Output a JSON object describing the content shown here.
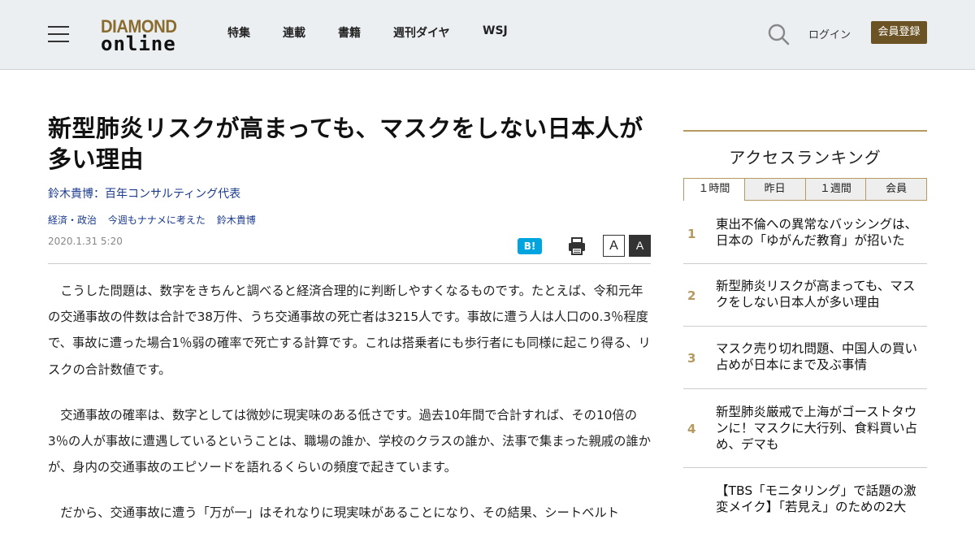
{
  "header": {
    "logo_top": "DIAMOND",
    "logo_bottom": "online",
    "nav": [
      "特集",
      "連載",
      "書籍",
      "週刊ダイヤ",
      "WSJ"
    ],
    "login": "ログイン",
    "register": "会員登録"
  },
  "article": {
    "title": "新型肺炎リスクが高まっても、マスクをしない日本人が多い理由",
    "author": "鈴木貴博：百年コンサルティング代表",
    "tags": [
      "経済・政治",
      "今週もナナメに考えた",
      "鈴木貴博"
    ],
    "date": "2020.1.31 5:20",
    "hatena": "B!",
    "font_small": "A",
    "font_large": "A",
    "paragraphs": [
      "こうした問題は、数字をきちんと調べると経済合理的に判断しやすくなるものです。たとえば、令和元年の交通事故の件数は合計で38万件、うち交通事故の死亡者は3215人です。事故に遭う人は人口の0.3％程度で、事故に遭った場合1％弱の確率で死亡する計算です。これは搭乗者にも歩行者にも同様に起こり得る、リスクの合計数値です。",
      "交通事故の確率は、数字としては微妙に現実味のある低さです。過去10年間で合計すれば、その10倍の3％の人が事故に遭遇しているということは、職場の誰か、学校のクラスの誰か、法事で集まった親戚の誰かが、身内の交通事故のエピソードを語れるくらいの頻度で起きています。",
      "だから、交通事故に遭う「万が一」はそれなりに現実味があることになり、その結果、シートベルト"
    ]
  },
  "ranking": {
    "heading": "アクセスランキング",
    "tabs": [
      "１時間",
      "昨日",
      "１週間",
      "会員"
    ],
    "active_tab": 0,
    "items": [
      {
        "num": "1",
        "title": "東出不倫への異常なバッシングは、日本の「ゆがんだ教育」が招いた"
      },
      {
        "num": "2",
        "title": "新型肺炎リスクが高まっても、マスクをしない日本人が多い理由"
      },
      {
        "num": "3",
        "title": "マスク売り切れ問題、中国人の買い占めが日本にまで及ぶ事情"
      },
      {
        "num": "4",
        "title": "新型肺炎厳戒で上海がゴーストタウンに！マスクに大行列、食料買い占め、デマも"
      },
      {
        "num": "",
        "title": "【TBS「モニタリング」で話題の激変メイク】「若見え」のための2大"
      }
    ]
  },
  "colors": {
    "header_bg": "#eceff2",
    "logo_gold": "#8a6c2f",
    "register_bg": "#6b5325",
    "link_blue": "#1a3a8c",
    "rank_gold": "#b49a5e",
    "hatena_blue": "#00a4de"
  }
}
